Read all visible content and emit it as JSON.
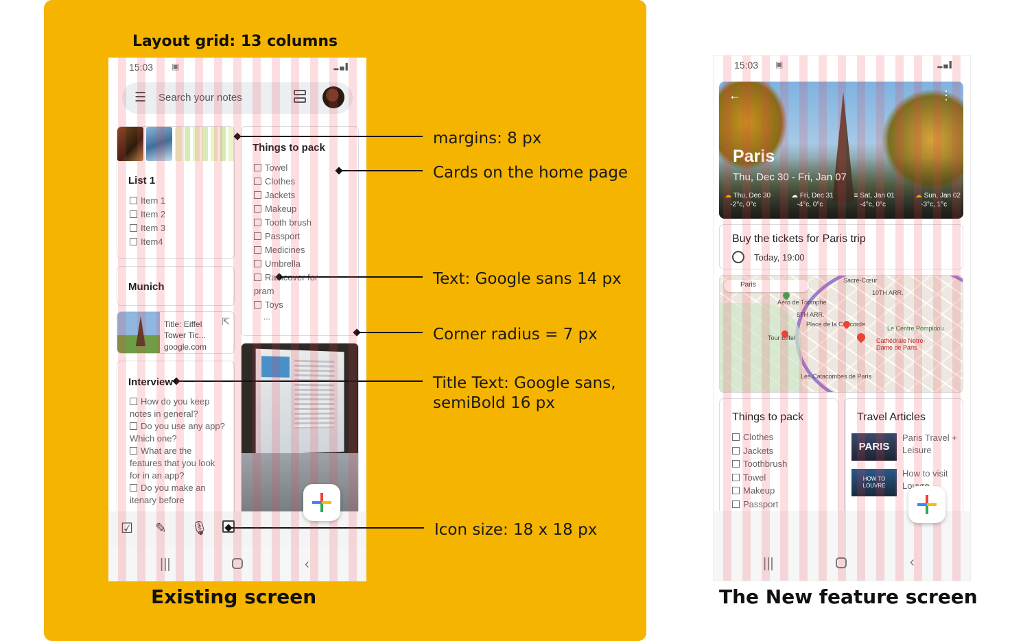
{
  "left_panel": {
    "heading": "Layout grid: 13 columns",
    "caption": "Existing screen",
    "phone": {
      "time": "15:03",
      "search_placeholder": "Search your notes",
      "list1": {
        "title": "List 1",
        "items": [
          "Item 1",
          "Item 2",
          "Item 3",
          "Item4"
        ]
      },
      "munich": "Munich",
      "link_card": {
        "title": "Title: Eiffel Tower Tic...",
        "domain": "google.com"
      },
      "interview": {
        "title": "Interview",
        "items": [
          "How do you keep notes in general?",
          "Do you use any app? Which one?",
          "What are the features that you look for in an app?",
          "Do you make an itenary before"
        ]
      },
      "things": {
        "title": "Things to pack",
        "items": [
          "Towel",
          "Clothes",
          "Jackets",
          "Makeup",
          "Tooth brush",
          "Passport",
          "Medicines",
          "Umbrella",
          "Raincover for pram",
          "Toys"
        ],
        "more": "..."
      }
    },
    "callouts": [
      "margins: 8 px",
      "Cards on the home page",
      "Text: Google sans 14 px",
      "Corner radius = 7 px",
      "Title Text: Google sans, semiBold 16 px",
      "Icon size: 18 x 18 px"
    ]
  },
  "right_panel": {
    "caption": "The New feature screen",
    "phone": {
      "time": "15:03",
      "hero": {
        "city": "Paris",
        "dates": "Thu, Dec 30 - Fri, Jan 07",
        "forecast": [
          {
            "day": "Thu, Dec 30",
            "temp": "-2°c, 0°c"
          },
          {
            "day": "Fri, Dec 31",
            "temp": "-4°c, 0°c"
          },
          {
            "day": "Sat, Jan 01",
            "temp": "-4°c, 0°c"
          },
          {
            "day": "Sun, Jan 02",
            "temp": "-3°c, 1°c"
          }
        ]
      },
      "reminder": {
        "title": "Buy the tickets for Paris trip",
        "time": "Today, 19:00"
      },
      "map": {
        "search": "Paris",
        "labels": [
          "Aéro de Triomphe",
          "8TH ARR.",
          "10TH ARR.",
          "Place de la Concorde",
          "Le Centre Pompidou",
          "Cathédrale Notre-Dame de Paris",
          "Tour Eiffel",
          "Les Catacombes de Paris",
          "Sacré-Cœur"
        ]
      },
      "things": {
        "title": "Things to pack",
        "items": [
          "Clothes",
          "Jackets",
          "Toothbrush",
          "Towel",
          "Makeup",
          "Passport"
        ]
      },
      "articles": {
        "title": "Travel Articles",
        "items": [
          {
            "thumb": "PARIS",
            "text": "Paris Travel + Leisure"
          },
          {
            "thumb": "HOW TO LOUVRE",
            "text": "How to visit Louvre"
          }
        ]
      }
    }
  },
  "colors": {
    "panel": "#f5b400",
    "grid": "#eb3c50",
    "accent_red": "#ea4335",
    "accent_blue": "#4285f4",
    "accent_yellow": "#fbbc04",
    "accent_green": "#34a853"
  }
}
